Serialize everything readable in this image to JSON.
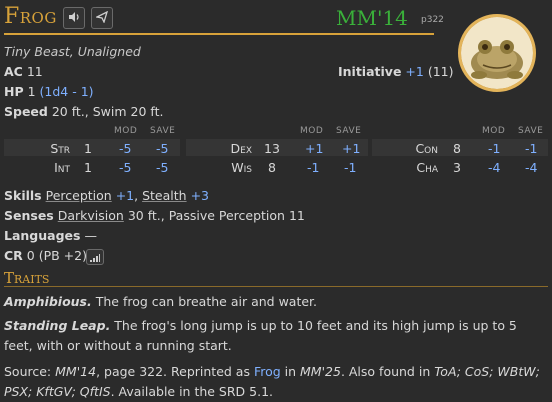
{
  "header": {
    "title": "Frog",
    "source_abbrev": "MM'14",
    "source_page": "p322"
  },
  "subtitle": "Tiny Beast, Unaligned",
  "ac": {
    "label": "AC",
    "value": "11"
  },
  "initiative": {
    "label": "Initiative",
    "mod": "+1",
    "score": "(11)"
  },
  "hp": {
    "label": "HP",
    "value": "1",
    "formula": "(1d4 - 1)"
  },
  "speed": {
    "label": "Speed",
    "value": "20 ft., Swim 20 ft."
  },
  "stat_headers": {
    "mod": "MOD",
    "save": "SAVE"
  },
  "abilities": [
    {
      "name": "Str",
      "score": "1",
      "mod": "-5",
      "save": "-5"
    },
    {
      "name": "Int",
      "score": "1",
      "mod": "-5",
      "save": "-5"
    },
    {
      "name": "Dex",
      "score": "13",
      "mod": "+1",
      "save": "+1"
    },
    {
      "name": "Wis",
      "score": "8",
      "mod": "-1",
      "save": "-1"
    },
    {
      "name": "Con",
      "score": "8",
      "mod": "-1",
      "save": "-1"
    },
    {
      "name": "Cha",
      "score": "3",
      "mod": "-4",
      "save": "-4"
    }
  ],
  "skills": {
    "label": "Skills",
    "s1_name": "Perception",
    "s1_val": "+1",
    "sep": ",",
    "s2_name": "Stealth",
    "s2_val": "+3"
  },
  "senses": {
    "label": "Senses",
    "darkvision": "Darkvision",
    "rest": "30 ft., Passive Perception 11"
  },
  "languages": {
    "label": "Languages",
    "value": "—"
  },
  "cr": {
    "label": "CR",
    "value": "0 (PB +2)"
  },
  "traits": {
    "heading": "Traits",
    "t1_name": "Amphibious.",
    "t1_text": " The frog can breathe air and water.",
    "t2_name": "Standing Leap.",
    "t2_text": " The frog's long jump is up to 10 feet and its high jump is up to 5 feet, with or without a running start."
  },
  "source": {
    "label": "Source:",
    "book": "MM'14",
    "p1": ", page 322. Reprinted as ",
    "link": "Frog",
    "p2": " in ",
    "book2": "MM'25",
    "p3": ". Also found in ",
    "list": "ToA; CoS; WBtW; PSX; KftGV; QftIS",
    "p4": ". Available in the SRD 5.1."
  },
  "icons": {
    "speaker": "speaker-icon",
    "send": "send-icon",
    "bars": "bars-icon"
  }
}
